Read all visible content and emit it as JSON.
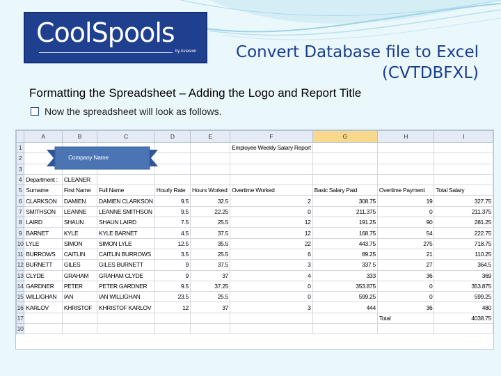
{
  "logo": {
    "text": "CoolSpools",
    "byline": "by Aviasion"
  },
  "slide": {
    "title": "Convert Database file to Excel (CVTDBFXL)",
    "heading": "Formatting the Spreadsheet – Adding the Logo and Report Title",
    "bullet": "Now the spreadsheet will look as follows."
  },
  "sheet": {
    "columns": [
      "A",
      "B",
      "C",
      "D",
      "E",
      "F",
      "G",
      "H",
      "I"
    ],
    "selected_column": "G",
    "banner_label": "Company Name",
    "report_title": "Employee Weekly Salary Report",
    "row_numbers": [
      "1",
      "2",
      "3",
      "4",
      "5",
      "6",
      "7",
      "8",
      "9",
      "10",
      "11",
      "12",
      "13",
      "14",
      "15",
      "16",
      "17",
      "18"
    ],
    "department_label": "Department :",
    "department_value": "CLEANER",
    "headers": [
      "Surname",
      "First Name",
      "Full Name",
      "Hourly Rate",
      "Hours Worked",
      "Overtime Worked",
      "Basic Salary Paid",
      "Overtime Payment",
      "Total Salary"
    ],
    "rows": [
      [
        "CLARKSON",
        "DAMIEN",
        "DAMIEN CLARKSON",
        "9.5",
        "32.5",
        "2",
        "308.75",
        "19",
        "327.75"
      ],
      [
        "SMITHSON",
        "LEANNE",
        "LEANNE SMITHSON",
        "9.5",
        "22.25",
        "0",
        "211.375",
        "0",
        "211.375"
      ],
      [
        "LAIRD",
        "SHAUN",
        "SHAUN LAIRD",
        "7.5",
        "25.5",
        "12",
        "191.25",
        "90",
        "281.25"
      ],
      [
        "BARNET",
        "KYLE",
        "KYLE BARNET",
        "4.5",
        "37.5",
        "12",
        "168.75",
        "54",
        "222.75"
      ],
      [
        "LYLE",
        "SIMON",
        "SIMON LYLE",
        "12.5",
        "35.5",
        "22",
        "443.75",
        "275",
        "718.75"
      ],
      [
        "BURROWS",
        "CAITLIN",
        "CAITLIN BURROWS",
        "3.5",
        "25.5",
        "6",
        "89.25",
        "21",
        "110.25"
      ],
      [
        "BURNETT",
        "GILES",
        "GILES BURNETT",
        "9",
        "37.5",
        "3",
        "337.5",
        "27",
        "364.5"
      ],
      [
        "CLYDE",
        "GRAHAM",
        "GRAHAM CLYDE",
        "9",
        "37",
        "4",
        "333",
        "36",
        "369"
      ],
      [
        "GARDNER",
        "PETER",
        "PETER GARDNER",
        "9.5",
        "37.25",
        "0",
        "353.875",
        "0",
        "353.875"
      ],
      [
        "WILLIGHAN",
        "IAN",
        "IAN WILLIGHAN",
        "23.5",
        "25.5",
        "0",
        "599.25",
        "0",
        "599.25"
      ],
      [
        "KARLOV",
        "KHRISTOF",
        "KHRISTOF KARLOV",
        "12",
        "37",
        "3",
        "444",
        "36",
        "480"
      ]
    ],
    "total_label": "Total",
    "total_value": "4038.75",
    "last_row_number": "10"
  },
  "colors": {
    "title": "#1a3d8c",
    "logo_bg": "#1f3f8f",
    "banner": "#4a74b4",
    "selected_col": "#f8d88a",
    "header_bg": "#e4ebf5"
  }
}
